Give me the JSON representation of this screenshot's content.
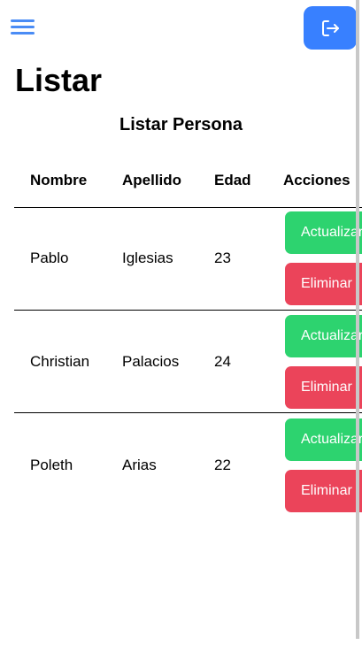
{
  "header": {
    "menu_icon": "hamburger-menu-icon",
    "logout_icon": "logout-icon",
    "accent_color": "#3880ff"
  },
  "page": {
    "title": "Listar"
  },
  "table": {
    "title": "Listar Persona",
    "columns": [
      "Nombre",
      "Apellido",
      "Edad",
      "Acciones"
    ],
    "rows": [
      {
        "nombre": "Pablo",
        "apellido": "Iglesias",
        "edad": "23",
        "update_label": "Actualizar",
        "delete_label": "Eliminar"
      },
      {
        "nombre": "Christian",
        "apellido": "Palacios",
        "edad": "24",
        "update_label": "Actualizar",
        "delete_label": "Eliminar"
      },
      {
        "nombre": "Poleth",
        "apellido": "Arias",
        "edad": "22",
        "update_label": "Actualizar",
        "delete_label": "Eliminar"
      }
    ],
    "update_color": "#2dd36f",
    "delete_color": "#eb445a"
  }
}
